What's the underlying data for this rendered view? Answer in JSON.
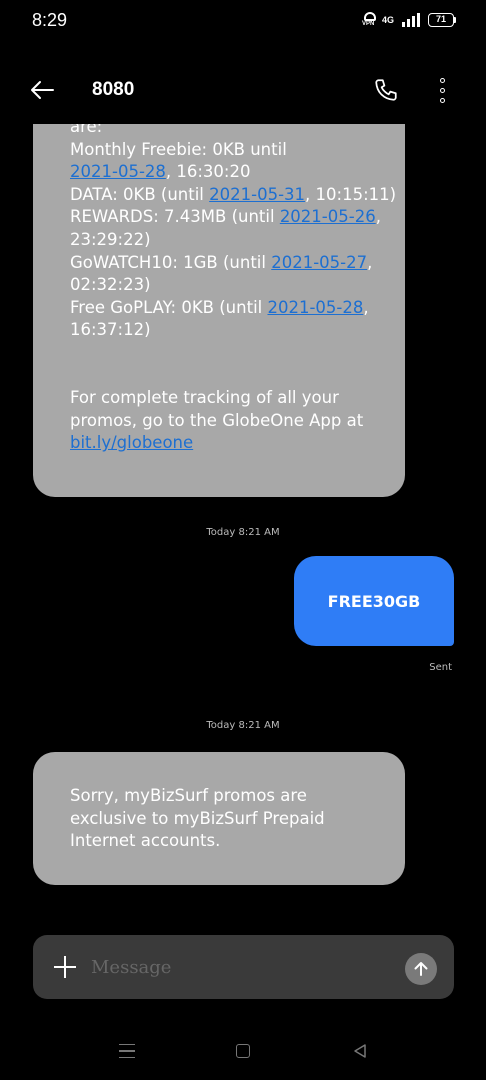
{
  "status_bar": {
    "time": "8:29",
    "vpn_label": "VPN",
    "network": "4G",
    "battery": "71"
  },
  "header": {
    "title": "8080",
    "back_icon": "arrow-left-icon",
    "call_icon": "phone-icon",
    "more_icon": "more-vertical-icon"
  },
  "messages": [
    {
      "direction": "incoming",
      "lines": [
        [
          {
            "text": "are:"
          }
        ],
        [
          {
            "text": "Monthly Freebie: 0KB until"
          }
        ],
        [
          {
            "text": "2021-05-28",
            "link": true
          },
          {
            "text": ", 16:30:20"
          }
        ],
        [
          {
            "text": "DATA: 0KB (until "
          },
          {
            "text": "2021-05-31",
            "link": true
          },
          {
            "text": ", 10:15:11)"
          }
        ],
        [
          {
            "text": "REWARDS: 7.43MB (until "
          },
          {
            "text": "2021-05-26",
            "link": true
          },
          {
            "text": ","
          }
        ],
        [
          {
            "text": "23:29:22)"
          }
        ],
        [
          {
            "text": "GoWATCH10: 1GB (until "
          },
          {
            "text": "2021-05-27",
            "link": true
          },
          {
            "text": ","
          }
        ],
        [
          {
            "text": "02:32:23)"
          }
        ],
        [
          {
            "text": "Free GoPLAY: 0KB (until "
          },
          {
            "text": "2021-05-28",
            "link": true
          },
          {
            "text": ","
          }
        ],
        [
          {
            "text": "16:37:12)"
          }
        ],
        [],
        [
          {
            "text": "For complete tracking of all your"
          }
        ],
        [
          {
            "text": "promos, go to the GlobeOne App at"
          }
        ],
        [
          {
            "text": "bit.ly/globeone",
            "link": true
          }
        ]
      ]
    }
  ],
  "timestamp_1": "Today 8:21 AM",
  "outgoing": {
    "text": "FREE30GB",
    "status": "Sent"
  },
  "timestamp_2": "Today 8:21 AM",
  "incoming_2": {
    "lines": [
      "Sorry, myBizSurf promos are",
      "exclusive to myBizSurf Prepaid",
      "Internet accounts."
    ]
  },
  "composer": {
    "placeholder": "Message",
    "add_icon": "plus-icon",
    "send_icon": "arrow-up-icon"
  },
  "nav_bar": {
    "menu_icon": "menu-icon",
    "home_icon": "home-square-icon",
    "back_icon": "back-triangle-icon"
  },
  "colors": {
    "background": "#000000",
    "incoming_bubble": "#a8a8a8",
    "outgoing_bubble": "#2f7df6",
    "link": "#1d6fd1",
    "composer": "#3a3a3a"
  }
}
